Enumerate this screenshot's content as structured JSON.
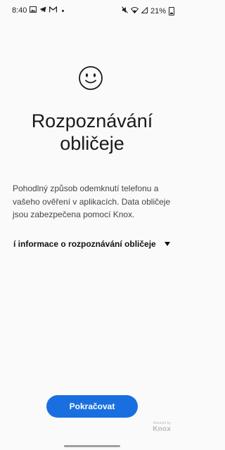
{
  "status_bar": {
    "time": "8:40",
    "left_icons": [
      "image-icon",
      "telegram-icon",
      "gmail-icon"
    ],
    "right_icons": [
      "mute-icon",
      "wifi-icon",
      "signal-icon"
    ],
    "battery": "21%"
  },
  "header": {
    "icon": "face-icon",
    "title_line1": "Rozpoznávání",
    "title_line2": "obličeje"
  },
  "description": "Pohodlný způsob odemknutí telefonu a vašeho ověření v aplikacích. Data obličeje jsou zabezpečena pomocí Knox.",
  "info_row": {
    "label": "í informace o rozpoznávání obličeje",
    "icon": "dropdown-arrow-icon"
  },
  "footer": {
    "continue_label": "Pokračovat",
    "secured_by": "Secured by",
    "brand": "Knox"
  },
  "colors": {
    "background": "#fafafa",
    "primary_button": "#1a6fe0"
  }
}
